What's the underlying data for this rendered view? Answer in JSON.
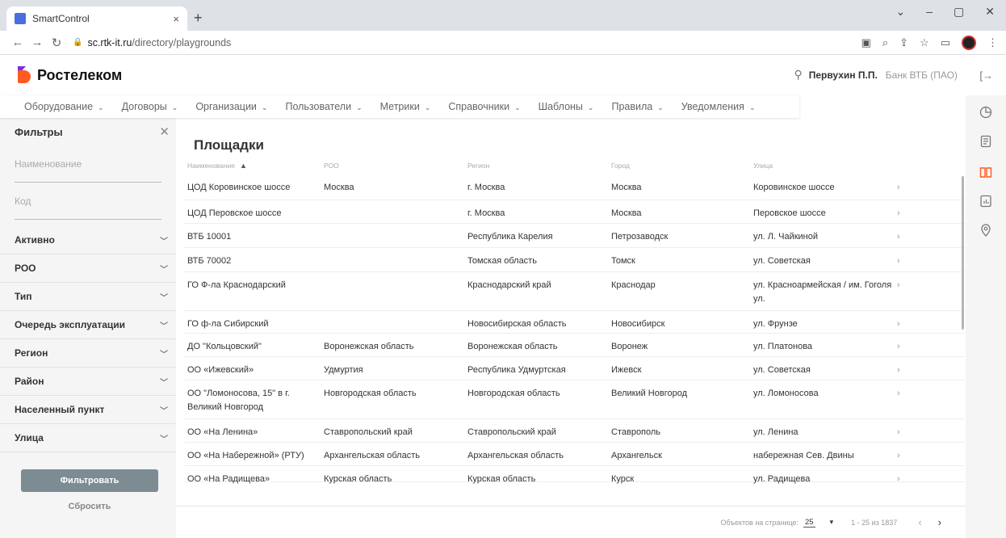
{
  "browser": {
    "tab_title": "SmartControl",
    "tab_close": "×",
    "new_tab": "+",
    "url_host": "sc.rtk-it.ru",
    "url_path": "/directory/playgrounds"
  },
  "header": {
    "logo_text": "Ростелеком",
    "user_name": "Первухин П.П.",
    "user_org": "Банк ВТБ (ПАО)"
  },
  "menu": [
    {
      "label": "Оборудование"
    },
    {
      "label": "Договоры"
    },
    {
      "label": "Организации"
    },
    {
      "label": "Пользователи"
    },
    {
      "label": "Метрики"
    },
    {
      "label": "Справочники"
    },
    {
      "label": "Шаблоны"
    },
    {
      "label": "Правила"
    },
    {
      "label": "Уведомления"
    }
  ],
  "filters": {
    "title": "Фильтры",
    "name_placeholder": "Наименование",
    "code_placeholder": "Код",
    "items": [
      "Активно",
      "РОО",
      "Тип",
      "Очередь эксплуатации",
      "Регион",
      "Район",
      "Населенный пункт",
      "Улица"
    ],
    "apply_label": "Фильтровать",
    "reset_label": "Сбросить"
  },
  "main": {
    "title": "Площадки",
    "columns": [
      "Наименование",
      "РОО",
      "Регион",
      "Город",
      "Улица"
    ],
    "rows": [
      {
        "name": "ЦОД Коровинское шоссе",
        "roo": "Москва",
        "region": "г. Москва",
        "city": "Москва",
        "street": "Коровинское шоссе",
        "h": 32
      },
      {
        "name": "ЦОД Перовское шоссе",
        "roo": "",
        "region": "г. Москва",
        "city": "Москва",
        "street": "Перовское шоссе",
        "h": 29
      },
      {
        "name": "ВТБ 10001",
        "roo": "",
        "region": "Республика Карелия",
        "city": "Петрозаводск",
        "street": "ул. Л. Чайкиной",
        "h": 30
      },
      {
        "name": "ВТБ 70002",
        "roo": "",
        "region": "Томская область",
        "city": "Томск",
        "street": "ул. Советская",
        "h": 30
      },
      {
        "name": "ГО Ф-ла Краснодарский",
        "roo": "",
        "region": "Краснодарский край",
        "city": "Краснодар",
        "street": "ул. Красноармейская / им. Гоголя ул.",
        "h": 48
      },
      {
        "name": "ГО ф-ла Сибирский",
        "roo": "",
        "region": "Новосибирская область",
        "city": "Новосибирск",
        "street": "ул. Фрунзе",
        "h": 28
      },
      {
        "name": "ДО \"Кольцовский\"",
        "roo": "Воронежская область",
        "region": "Воронежская область",
        "city": "Воронеж",
        "street": "ул. Платонова",
        "h": 29
      },
      {
        "name": "ОО «Ижевский»",
        "roo": "Удмуртия",
        "region": "Республика Удмуртская",
        "city": "Ижевск",
        "street": "ул. Советская",
        "h": 29
      },
      {
        "name": "ОО \"Ломоносова, 15\" в г. Великий Новгород",
        "roo": "Новгородская область",
        "region": "Новгородская область",
        "city": "Великий Новгород",
        "street": "ул. Ломоносова",
        "h": 48
      },
      {
        "name": "ОО «На Ленина»",
        "roo": "Ставропольский край",
        "region": "Ставропольский край",
        "city": "Ставрополь",
        "street": "ул. Ленина",
        "h": 29
      },
      {
        "name": "ОО «На Набережной» (РТУ)",
        "roo": "Архангельская область",
        "region": "Архангельская область",
        "city": "Архангельск",
        "street": "набережная Сев. Двины",
        "h": 29
      },
      {
        "name": "ОО «На Радищева»",
        "roo": "Курская область",
        "region": "Курская область",
        "city": "Курск",
        "street": "ул. Радищева",
        "h": 20
      }
    ]
  },
  "pager": {
    "per_page_label": "Объектов на странице:",
    "per_page_value": "25",
    "range": "1 - 25 из 1837"
  },
  "colors": {
    "accent": "#ff5a1f",
    "brand_purple": "#7b2fe0",
    "button": "#7d8b92"
  }
}
